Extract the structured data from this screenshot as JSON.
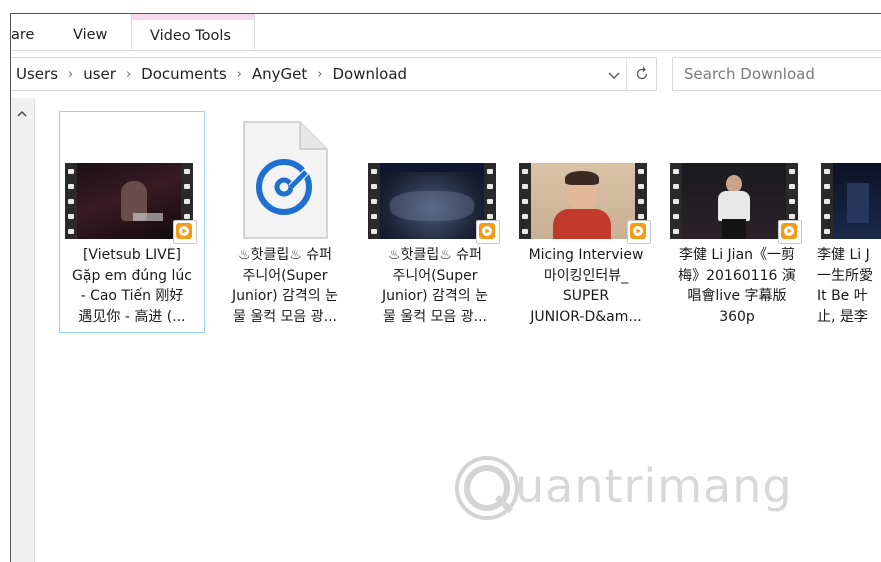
{
  "ribbon": {
    "tabs": [
      {
        "label": "are"
      },
      {
        "label": "View"
      },
      {
        "label": "Video Tools"
      }
    ]
  },
  "address": {
    "crumbs": [
      "Users",
      "user",
      "Documents",
      "AnyGet",
      "Download"
    ],
    "search_placeholder": "Search Download"
  },
  "files": [
    {
      "name": "[Vietsub LIVE]\nGặp em đúng lúc\n- Cao Tiến  刚好\n遇见你 - 高进 (...",
      "type": "video",
      "selected": true
    },
    {
      "name": "♨핫클립♨ 슈퍼\n주니어(Super\nJunior) 감격의 눈\n물 울컥 모음 광...",
      "type": "groove-music"
    },
    {
      "name": "♨핫클립♨ 슈퍼\n주니어(Super\nJunior) 감격의 눈\n물 울컥 모음 광...",
      "type": "video"
    },
    {
      "name": "Micing Interview\n마이킹인터뷰_\nSUPER\nJUNIOR-D&am...",
      "type": "video"
    },
    {
      "name": "李健 Li Jian《一剪\n梅》20160116 演\n唱會live 字幕版\n360p",
      "type": "video"
    },
    {
      "name": "李健 Li J\n一生所愛\nIt Be 叶\n止, 是李",
      "type": "video"
    }
  ],
  "watermark": {
    "text": "uantrimang"
  }
}
